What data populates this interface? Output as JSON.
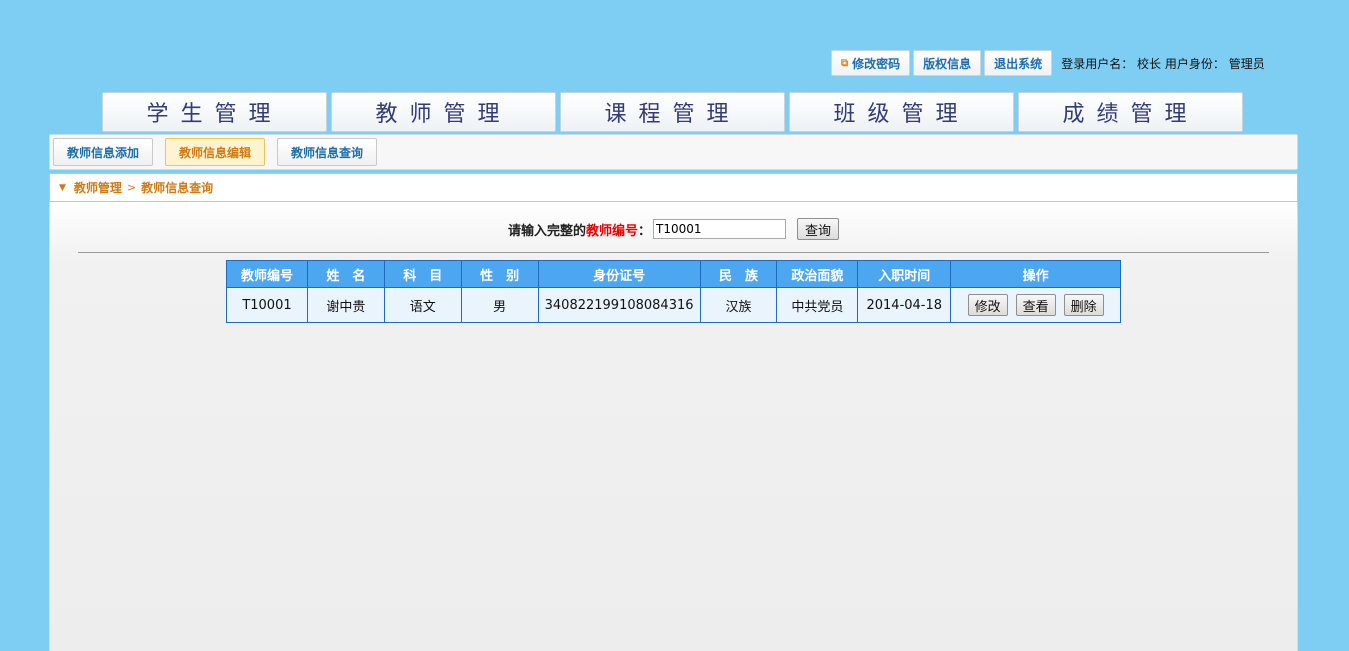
{
  "topbar": {
    "change_password": "修改密码",
    "copyright": "版权信息",
    "logout": "退出系统",
    "user_label": "登录用户名：",
    "user_name": "校长",
    "role_label": "用户身份：",
    "role_name": "管理员"
  },
  "main_nav": [
    {
      "label": "学生管理"
    },
    {
      "label": "教师管理"
    },
    {
      "label": "课程管理"
    },
    {
      "label": "班级管理"
    },
    {
      "label": "成绩管理"
    }
  ],
  "sub_nav": [
    {
      "label": "教师信息添加",
      "active": false
    },
    {
      "label": "教师信息编辑",
      "active": true
    },
    {
      "label": "教师信息查询",
      "active": false
    }
  ],
  "breadcrumb": {
    "parent": "教师管理",
    "separator": ">",
    "current": "教师信息查询"
  },
  "search": {
    "label_prefix": "请输入完整的",
    "label_field": "教师编号",
    "label_suffix": "：",
    "value": "T10001",
    "button": "查询"
  },
  "table": {
    "headers": [
      "教师编号",
      "姓　名",
      "科　目",
      "性　别",
      "身份证号",
      "民　族",
      "政治面貌",
      "入职时间",
      "操作"
    ],
    "rows": [
      {
        "id": "T10001",
        "name": "谢中贵",
        "subject": "语文",
        "gender": "男",
        "id_card": "340822199108084316",
        "ethnicity": "汉族",
        "political": "中共党员",
        "hire_date": "2014-04-18",
        "actions": [
          "修改",
          "查看",
          "删除"
        ]
      }
    ]
  },
  "colors": {
    "background": "#7ecef4",
    "header_blue": "#4da7f0",
    "accent_orange": "#d27a12",
    "link_blue": "#1e6fa8",
    "required_red": "#e00000"
  }
}
